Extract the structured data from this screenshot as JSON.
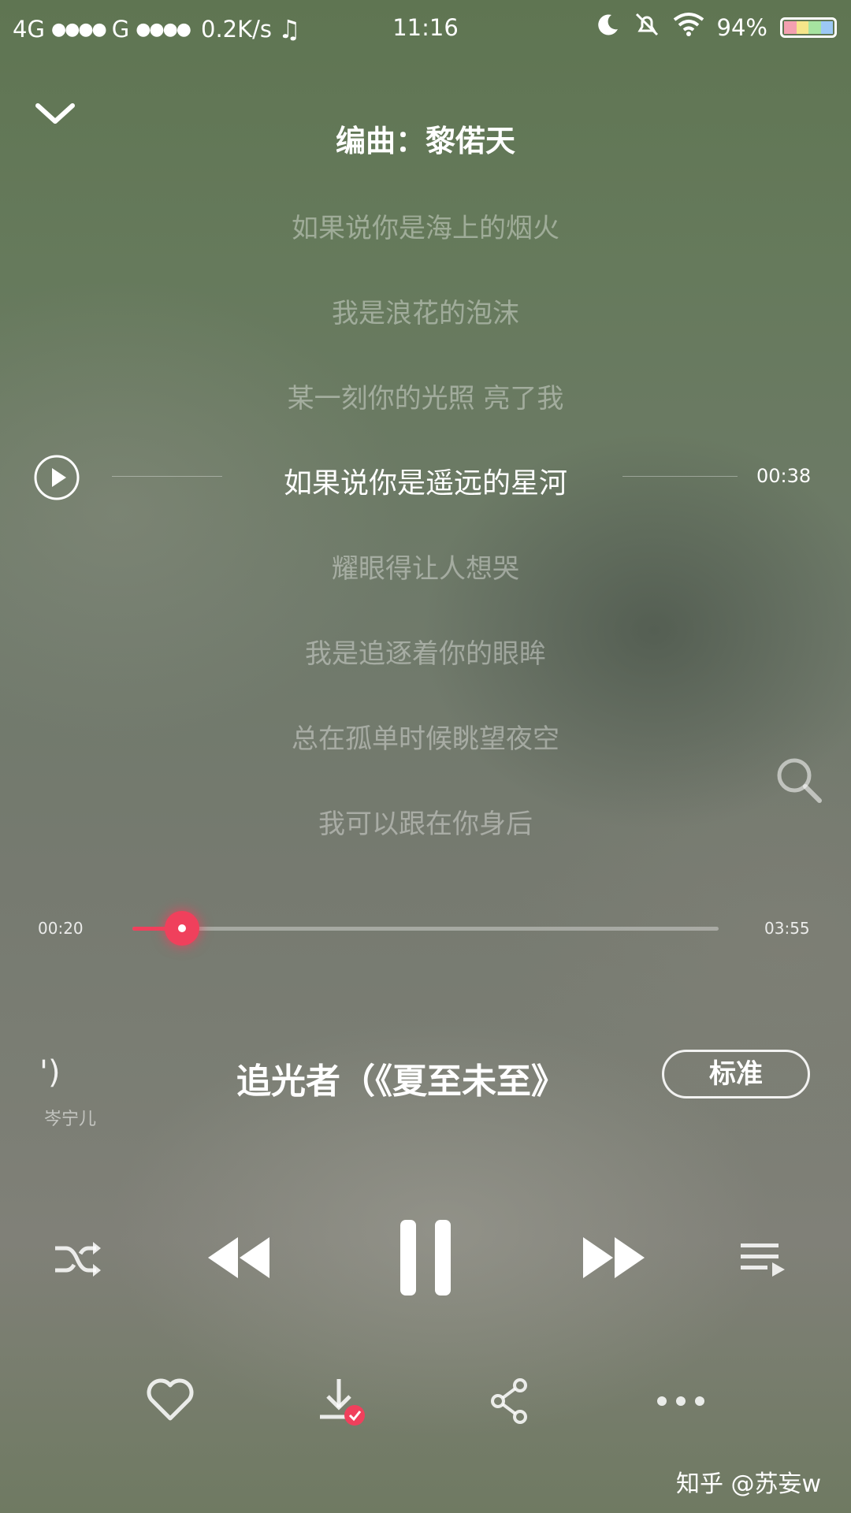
{
  "status_bar": {
    "network1": "4G",
    "network2": "G",
    "speed": "0.2K/s",
    "time": "11:16",
    "battery": "94%"
  },
  "header": {
    "composer": "编曲：黎偌天"
  },
  "lyrics": {
    "lines": [
      "如果说你是海上的烟火",
      "我是浪花的泡沫",
      "某一刻你的光照 亮了我",
      "如果说你是遥远的星河",
      "耀眼得让人想哭",
      "我是追逐着你的眼眸",
      "总在孤单时候眺望夜空",
      "我可以跟在你身后"
    ],
    "active_index": 3,
    "active_time": "00:38"
  },
  "progress": {
    "elapsed": "00:20",
    "total": "03:55",
    "fraction": 0.085
  },
  "song": {
    "prev_fragment": "')",
    "prev_artist": "岑宁儿",
    "title": "追光者（《夏至未至》",
    "quality": "标准"
  },
  "colors": {
    "accent": "#f0405c"
  },
  "icons": {
    "collapse": "chevron-down-icon",
    "lyric_play": "play-circle-icon",
    "search": "search-icon",
    "shuffle": "shuffle-icon",
    "prev": "previous-icon",
    "pause": "pause-icon",
    "next": "next-icon",
    "playlist": "playlist-icon",
    "like": "heart-icon",
    "download": "download-icon",
    "share": "share-icon",
    "more": "more-icon"
  },
  "watermark": "知乎 @苏妄w"
}
